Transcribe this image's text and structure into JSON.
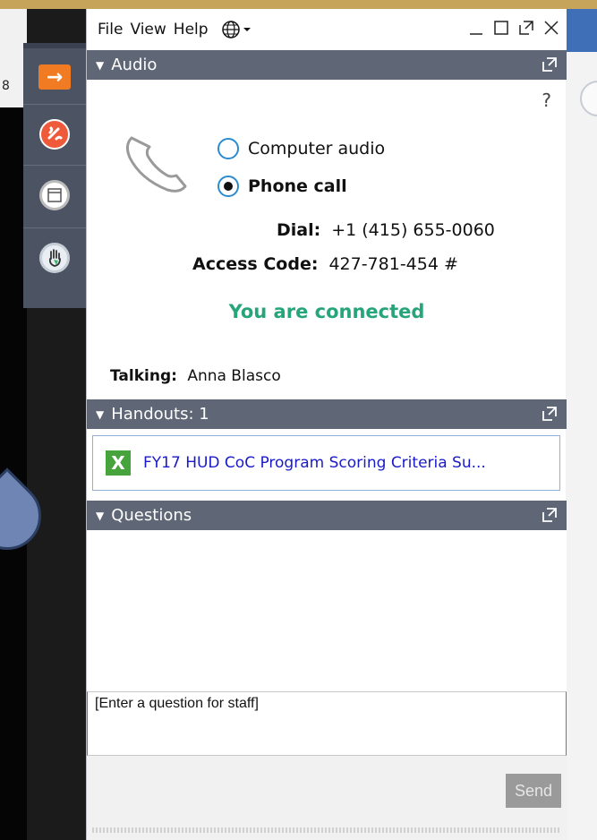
{
  "background": {
    "clipped_text": "8"
  },
  "menubar": {
    "file": "File",
    "view": "View",
    "help": "Help"
  },
  "sections": {
    "audio": "Audio",
    "handouts": "Handouts: 1",
    "questions": "Questions"
  },
  "audio": {
    "help_symbol": "?",
    "options": {
      "computer": "Computer audio",
      "phone": "Phone call"
    },
    "selected": "phone",
    "dial_label": "Dial:",
    "dial_value": "+1 (415) 655-0060",
    "access_label": "Access Code:",
    "access_value": "427-781-454 #",
    "status": "You are connected",
    "talking_label": "Talking:",
    "talking_name": "Anna Blasco"
  },
  "handouts": {
    "file_icon_letter": "X",
    "file_name": "FY17 HUD CoC Program Scoring Criteria Su..."
  },
  "questions": {
    "placeholder": "[Enter a question for staff]",
    "send_label": "Send"
  },
  "colors": {
    "header": "#5f6676",
    "connected": "#27a57a",
    "link": "#1a1acb",
    "accent_orange": "#f07b22",
    "radio_border": "#2a8ccf"
  }
}
